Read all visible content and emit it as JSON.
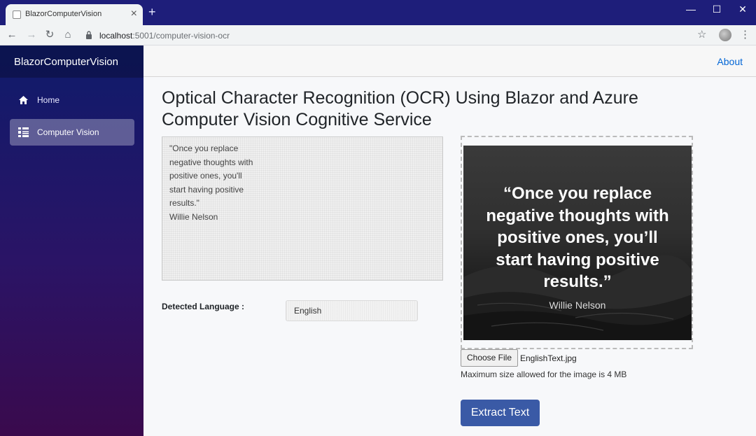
{
  "browser": {
    "tab_title": "BlazorComputerVision",
    "tab_close": "×",
    "new_tab": "+",
    "url_host": "localhost",
    "url_path": ":5001/computer-vision-ocr",
    "window_controls": {
      "minimize": "—",
      "maximize": "☐",
      "close": "✕"
    }
  },
  "sidebar": {
    "brand": "BlazorComputerVision",
    "items": [
      {
        "label": "Home",
        "icon": "home-icon",
        "active": false
      },
      {
        "label": "Computer Vision",
        "icon": "list-icon",
        "active": true
      }
    ]
  },
  "header": {
    "about": "About"
  },
  "page": {
    "title": "Optical Character Recognition (OCR) Using Blazor and Azure Computer Vision Cognitive Service",
    "ocr_text": "\"Once you replace\nnegative thoughts with\npositive ones, you'll\nstart having positive\nresults.\"\nWillie Nelson",
    "detected_language_label": "Detected Language :",
    "detected_language": "English",
    "image_quote": "“Once you replace\nnegative thoughts with\npositive ones, you’ll\nstart having positive\nresults.”",
    "image_author": "Willie Nelson",
    "choose_file_label": "Choose File",
    "file_name": "EnglishText.jpg",
    "max_size_note": "Maximum size allowed for the image is 4 MB",
    "extract_button": "Extract Text"
  },
  "colors": {
    "accent": "#3a5aa6",
    "link": "#0366d6",
    "sidebar_top": "#0f1b6b",
    "sidebar_bottom": "#3a0a4d"
  }
}
